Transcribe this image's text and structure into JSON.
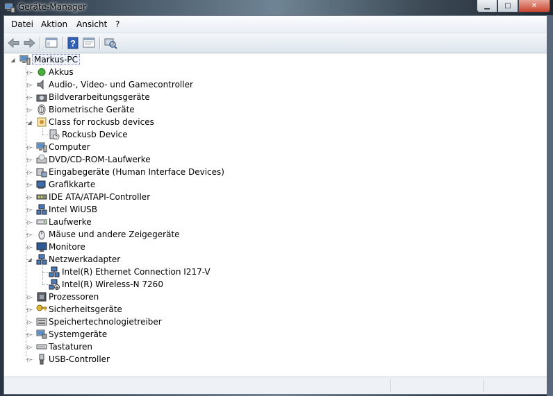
{
  "window": {
    "title": "Geräte-Manager"
  },
  "menu": [
    "Datei",
    "Aktion",
    "Ansicht",
    "?"
  ],
  "toolbar": {
    "buttons": [
      "back-arrow-icon",
      "forward-arrow-icon",
      "show-hide-console-tree-icon",
      "help-icon",
      "properties-icon",
      "scan-hardware-icon"
    ]
  },
  "tree": {
    "root": "Markus-PC",
    "items": [
      {
        "label": "Akkus",
        "icon": "battery-icon",
        "expanded": false
      },
      {
        "label": "Audio-, Video- und Gamecontroller",
        "icon": "speaker-icon",
        "expanded": false
      },
      {
        "label": "Bildverarbeitungsgeräte",
        "icon": "camera-icon",
        "expanded": false
      },
      {
        "label": "Biometrische Geräte",
        "icon": "fingerprint-icon",
        "expanded": false
      },
      {
        "label": "Class for rockusb devices",
        "icon": "device-class-icon",
        "expanded": true,
        "children": [
          {
            "label": "Rockusb Device",
            "icon": "unknown-device-icon"
          }
        ]
      },
      {
        "label": "Computer",
        "icon": "computer-icon",
        "expanded": false
      },
      {
        "label": "DVD/CD-ROM-Laufwerke",
        "icon": "dvd-drive-icon",
        "expanded": false
      },
      {
        "label": "Eingabegeräte (Human Interface Devices)",
        "icon": "hid-icon",
        "expanded": false
      },
      {
        "label": "Grafikkarte",
        "icon": "display-adapter-icon",
        "expanded": false
      },
      {
        "label": "IDE ATA/ATAPI-Controller",
        "icon": "ide-controller-icon",
        "expanded": false
      },
      {
        "label": "Intel WiUSB",
        "icon": "network-icon",
        "expanded": false
      },
      {
        "label": "Laufwerke",
        "icon": "disk-drive-icon",
        "expanded": false
      },
      {
        "label": "Mäuse und andere Zeigegeräte",
        "icon": "mouse-icon",
        "expanded": false
      },
      {
        "label": "Monitore",
        "icon": "monitor-icon",
        "expanded": false
      },
      {
        "label": "Netzwerkadapter",
        "icon": "network-adapter-icon",
        "expanded": true,
        "children": [
          {
            "label": "Intel(R) Ethernet Connection I217-V",
            "icon": "network-adapter-icon"
          },
          {
            "label": "Intel(R) Wireless-N 7260",
            "icon": "network-adapter-disabled-icon"
          }
        ]
      },
      {
        "label": "Prozessoren",
        "icon": "processor-icon",
        "expanded": false
      },
      {
        "label": "Sicherheitsgeräte",
        "icon": "key-icon",
        "expanded": false
      },
      {
        "label": "Speichertechnologietreiber",
        "icon": "storage-icon",
        "expanded": false
      },
      {
        "label": "Systemgeräte",
        "icon": "system-devices-icon",
        "expanded": false
      },
      {
        "label": "Tastaturen",
        "icon": "keyboard-icon",
        "expanded": false
      },
      {
        "label": "USB-Controller",
        "icon": "usb-icon",
        "expanded": false
      }
    ]
  }
}
